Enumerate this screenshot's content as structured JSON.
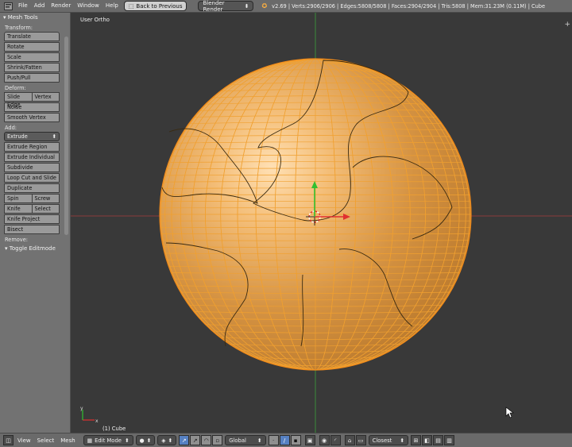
{
  "menubar": {
    "items": [
      "File",
      "Add",
      "Render",
      "Window",
      "Help"
    ],
    "back_button": "Back to Previous",
    "render_engine": "Blender Render",
    "status": "v2.69 | Verts:2906/2906 | Edges:5808/5808 | Faces:2904/2904 | Tris:5808 | Mem:31.23M (0.11M) | Cube"
  },
  "toolshelf": {
    "title": "Mesh Tools",
    "transform_label": "Transform:",
    "transform": [
      "Translate",
      "Rotate",
      "Scale",
      "Shrink/Fatten",
      "Push/Pull"
    ],
    "deform_label": "Deform:",
    "slide_edge": "Slide Edge",
    "vertex": "Vertex",
    "noise": "Noise",
    "smooth_vertex": "Smooth Vertex",
    "add_label": "Add:",
    "extrude_dropdown": "Extrude",
    "extrude_region": "Extrude Region",
    "extrude_individual": "Extrude Individual",
    "subdivide": "Subdivide",
    "loop_cut": "Loop Cut and Slide",
    "duplicate": "Duplicate",
    "spin": "Spin",
    "screw": "Screw",
    "knife": "Knife",
    "select": "Select",
    "knife_project": "Knife Project",
    "bisect": "Bisect",
    "remove_label": "Remove:",
    "toggle_editmode": "Toggle Editmode"
  },
  "viewport": {
    "view_name": "User Ortho",
    "object_label": "(1) Cube",
    "accent_orange": "#f0a030",
    "x_axis_color": "#e03030",
    "y_axis_color": "#30c030"
  },
  "bottombar": {
    "menus": [
      "View",
      "Select",
      "Mesh"
    ],
    "mode": "Edit Mode",
    "orientation": "Global",
    "snap_target": "Closest"
  }
}
